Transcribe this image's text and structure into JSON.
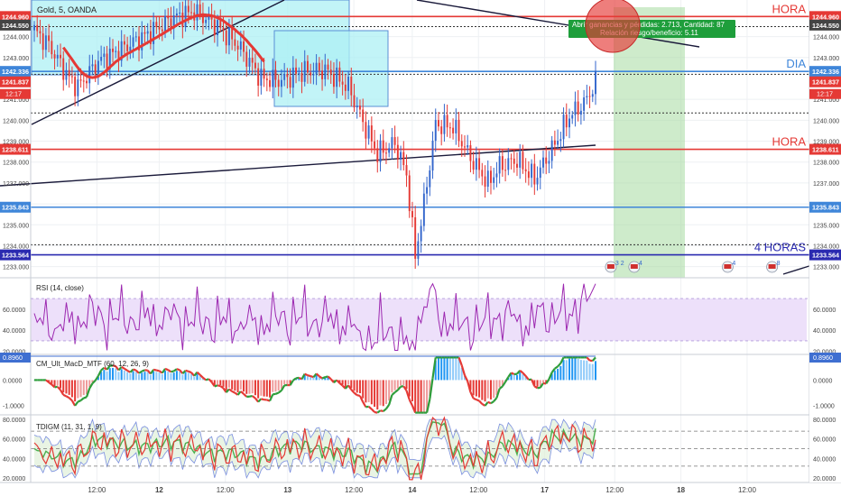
{
  "symbol_label": "Gold, 5, OANDA",
  "colors": {
    "bull": "#3366cc",
    "bear": "#e53935",
    "ma": "#e53935",
    "red_line": "#e53935",
    "blue_line": "#3f86d9",
    "navy_line": "#2a2ab0",
    "box_fill": "#aef0f4",
    "box_stroke": "#5a8fd6",
    "profit_zone": "#a5dba0",
    "rsi_band": "#ede0fa",
    "rsi_line": "#9c27b0",
    "tdi_green": "#4caf50",
    "tdi_red": "#e53935",
    "tdi_band": "#7a8ee0"
  },
  "price_axis": {
    "ticks": [
      "1244.000",
      "1243.000",
      "1241.000",
      "1240.000",
      "1239.000",
      "1238.000",
      "1237.000",
      "1236.000",
      "1235.000",
      "1234.000",
      "1233.000"
    ],
    "tick_values": [
      1244,
      1243,
      1241,
      1240,
      1239,
      1238,
      1237,
      1236,
      1235,
      1234,
      1233
    ],
    "range": [
      1232.9,
      1245.75
    ],
    "time_badge": "12:17"
  },
  "price_tags": [
    {
      "label": "1244.960",
      "value": 1244.96,
      "color": "#e53935"
    },
    {
      "label": "1244.550",
      "value": 1244.55,
      "color": "#444444"
    },
    {
      "label": "1242.336",
      "value": 1242.336,
      "color": "#3f86d9"
    },
    {
      "label": "1241.837",
      "value": 1241.837,
      "color": "#e53935"
    },
    {
      "label": "1238.611",
      "value": 1238.611,
      "color": "#e53935"
    },
    {
      "label": "1235.843",
      "value": 1235.843,
      "color": "#3f86d9"
    },
    {
      "label": "1233.564",
      "value": 1233.564,
      "color": "#2a2ab0"
    }
  ],
  "levels": [
    {
      "name": "hora-top",
      "label": "HORA",
      "value": 1244.96,
      "color": "#e53935"
    },
    {
      "name": "dia",
      "label": "DIA",
      "value": 1242.336,
      "color": "#3f86d9"
    },
    {
      "name": "hora-mid",
      "label": "HORA",
      "value": 1238.611,
      "color": "#e53935"
    },
    {
      "name": "support",
      "label": "",
      "value": 1235.843,
      "color": "#3f86d9"
    },
    {
      "name": "4-horas",
      "label": "4 HORAS",
      "value": 1233.564,
      "color": "#2a2ab0"
    }
  ],
  "dotted_levels": [
    1244.48,
    1242.2,
    1240.35,
    1234.05
  ],
  "trade_tooltip": {
    "line1": "Abrir ganancias y pérdidas: 2.713, Cantidad: 87",
    "line2": "Relación riesgo/beneficio: 5.11"
  },
  "event_icons": [
    {
      "label": "3 2",
      "x_pos": 0.745
    },
    {
      "label": "4",
      "x_pos": 0.775
    },
    {
      "label": "4",
      "x_pos": 0.895
    },
    {
      "label": "8",
      "x_pos": 0.952
    }
  ],
  "time_axis": {
    "labels": [
      "12:00",
      "12",
      "12:00",
      "13",
      "12:00",
      "14",
      "12:00",
      "17",
      "12:00",
      "18",
      "12:00"
    ],
    "positions": [
      0.085,
      0.165,
      0.25,
      0.33,
      0.415,
      0.49,
      0.575,
      0.66,
      0.75,
      0.835,
      0.92
    ]
  },
  "rsi": {
    "label": "RSI (14, close)",
    "ticks": [
      "60.0000",
      "40.0000",
      "20.0000"
    ],
    "tick_values": [
      60,
      40,
      20
    ],
    "upper": 70,
    "lower": 30,
    "range": [
      18,
      88
    ]
  },
  "macd": {
    "label": "CM_Ult_MacD_MTF (60, 12, 26, 9)",
    "ticks": [
      "0.0000",
      "-1.0000"
    ],
    "tick_values": [
      0,
      -1
    ],
    "badge": "0.8960",
    "range": [
      -1.35,
      0.95
    ]
  },
  "tdi": {
    "label": "TDIGM (11, 31, 1, 9)",
    "ticks": [
      "80.0000",
      "60.0000",
      "40.0000",
      "20.0000"
    ],
    "tick_values": [
      80,
      60,
      40,
      20
    ],
    "range": [
      17,
      83
    ],
    "levels": [
      68,
      50,
      32
    ]
  },
  "chart_data": {
    "type": "candlestick",
    "symbol": "Gold, 5, OANDA",
    "y_range": [
      1233,
      1245
    ],
    "key_levels": {
      "HORA": [
        1244.96,
        1238.611
      ],
      "DIA": 1242.336,
      "4 HORAS": 1233.564,
      "other": [
        1244.55,
        1241.837,
        1235.843
      ]
    },
    "trade": {
      "open_pnl": 2.713,
      "quantity": 87,
      "risk_reward": 5.11
    },
    "indicators": [
      "RSI (14, close)",
      "CM_Ult_MacD_MTF (60, 12, 26, 9)",
      "TDIGM (11, 31, 1, 9)"
    ]
  }
}
